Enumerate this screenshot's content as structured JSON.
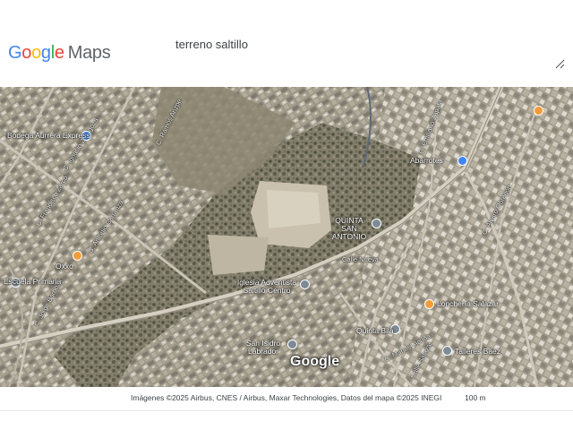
{
  "app": {
    "logo_parts": [
      "G",
      "o",
      "o",
      "g",
      "l",
      "e"
    ],
    "logo_product": "Maps",
    "search_query": "terreno saltillo"
  },
  "map": {
    "watermark": "Google",
    "places": [
      {
        "label": "Bodega Aurrera Express",
        "icon": "store-icon",
        "color": "#4285F4"
      },
      {
        "label": "Oxxo",
        "icon": "gas-station-icon",
        "color": "#F29C38"
      },
      {
        "label": "Escuela Primaria",
        "icon": "school-icon",
        "color": "#7d8b97"
      },
      {
        "label": "QUINTA SAN ANTONIO",
        "icon": "place-icon",
        "color": "#7d8b97"
      },
      {
        "label": "Iglesia Adventista Saltillo Centro",
        "icon": "church-icon",
        "color": "#7d8b97"
      },
      {
        "label": "Quinta Bila",
        "icon": "place-icon",
        "color": "#7d8b97"
      },
      {
        "label": "Lonchería Salazar",
        "icon": "restaurant-icon",
        "color": "#F29C38"
      },
      {
        "label": "Talleres Baez",
        "icon": "place-icon",
        "color": "#7d8b97"
      },
      {
        "label": "San Isidro Labrador",
        "icon": "church-icon",
        "color": "#7d8b97"
      },
      {
        "label": "Abarrotes",
        "icon": "store-icon",
        "color": "#4285F4"
      }
    ],
    "streets": [
      "C. Jorge Barboza",
      "C. Ignacio Zaragoza",
      "C. Francisco Zarco",
      "C. Ramos Arizpe",
      "C. Antonio Carranza",
      "Calle Nueva",
      "C. Manuel Acuña",
      "Calle Salazar",
      "C. Álvaro Obregón",
      "C. Emiliano Zapata"
    ]
  },
  "footer": {
    "attribution": "Imágenes ©2025 Airbus, CNES / Airbus, Maxar Technologies, Datos del mapa ©2025 INEGI",
    "scale": "100 m"
  }
}
